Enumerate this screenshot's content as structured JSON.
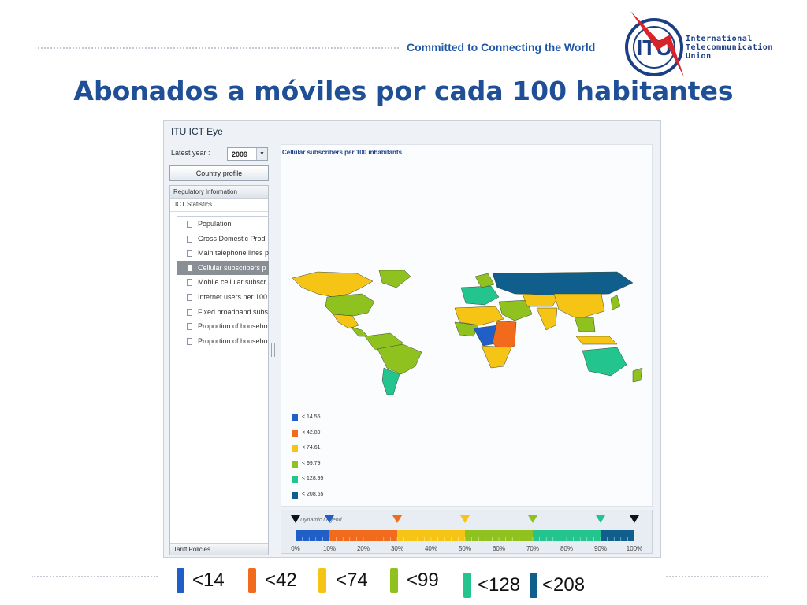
{
  "header": {
    "tagline": "Committed to Connecting the World",
    "logo_mark": "ITU",
    "logo_lines": [
      "International",
      "Telecommunication",
      "Union"
    ]
  },
  "slide_title": "Abonados a móviles por cada 100 habitantes",
  "app": {
    "title": "ITU ICT Eye",
    "year_label": "Latest year :",
    "year_value": "2009",
    "country_profile_button": "Country profile",
    "tree_header": "Regulatory Information",
    "tree_subheader": "ICT Statistics",
    "tree_items": [
      {
        "label": "Population",
        "selected": false
      },
      {
        "label": "Gross Domestic Prod",
        "selected": false
      },
      {
        "label": "Main telephone lines p",
        "selected": false
      },
      {
        "label": "Cellular subscribers p",
        "selected": true
      },
      {
        "label": "Mobile cellular subscr",
        "selected": false
      },
      {
        "label": "Internet users per 100",
        "selected": false
      },
      {
        "label": "Fixed broadband subs",
        "selected": false
      },
      {
        "label": "Proportion of househo",
        "selected": false
      },
      {
        "label": "Proportion of househo",
        "selected": false
      }
    ],
    "tree_footer": "Tariff Policies",
    "map_title": "Cellular subscribers per 100 inhabitants",
    "legend": [
      {
        "label": "< 14.55",
        "color": "#1f5fc7"
      },
      {
        "label": "< 42.89",
        "color": "#f26a1b"
      },
      {
        "label": "< 74.61",
        "color": "#f6c415"
      },
      {
        "label": "< 99.79",
        "color": "#8fc21f"
      },
      {
        "label": "< 128.95",
        "color": "#23c48e"
      },
      {
        "label": "< 208.65",
        "color": "#0f5e8c"
      }
    ],
    "dynamic_legend": {
      "title": "Dynamic Legend",
      "ticks": [
        "0%",
        "10%",
        "20%",
        "30%",
        "40%",
        "50%",
        "60%",
        "70%",
        "80%",
        "90%",
        "100%"
      ],
      "marker_positions_pct": [
        0,
        10,
        30,
        50,
        70,
        90,
        100
      ]
    }
  },
  "bottom_legend": [
    {
      "label": "<14",
      "color": "#1f5fc7"
    },
    {
      "label": "<42",
      "color": "#f26a1b"
    },
    {
      "label": "<74",
      "color": "#f6c415"
    },
    {
      "label": "<99",
      "color": "#8fc21f"
    },
    {
      "label": "<128",
      "color": "#23c48e"
    },
    {
      "label": "<208",
      "color": "#0f5e8c"
    }
  ],
  "map_regions": [
    {
      "name": "north-america",
      "color": "#f6c415"
    },
    {
      "name": "greenland",
      "color": "#8fc21f"
    },
    {
      "name": "usa",
      "color": "#8fc21f"
    },
    {
      "name": "mexico",
      "color": "#f6c415"
    },
    {
      "name": "central-america",
      "color": "#8fc21f"
    },
    {
      "name": "south-america-north",
      "color": "#8fc21f"
    },
    {
      "name": "brazil",
      "color": "#8fc21f"
    },
    {
      "name": "argentina",
      "color": "#23c48e"
    },
    {
      "name": "europe",
      "color": "#23c48e"
    },
    {
      "name": "scandinavia",
      "color": "#8fc21f"
    },
    {
      "name": "russia",
      "color": "#0f5e8c"
    },
    {
      "name": "north-africa",
      "color": "#f6c415"
    },
    {
      "name": "west-africa",
      "color": "#8fc21f"
    },
    {
      "name": "central-africa",
      "color": "#1f5fc7"
    },
    {
      "name": "east-africa",
      "color": "#f26a1b"
    },
    {
      "name": "southern-africa",
      "color": "#f6c415"
    },
    {
      "name": "middle-east",
      "color": "#8fc21f"
    },
    {
      "name": "central-asia",
      "color": "#f6c415"
    },
    {
      "name": "india",
      "color": "#f6c415"
    },
    {
      "name": "china",
      "color": "#f6c415"
    },
    {
      "name": "southeast-asia",
      "color": "#8fc21f"
    },
    {
      "name": "indonesia",
      "color": "#f6c415"
    },
    {
      "name": "australia",
      "color": "#23c48e"
    },
    {
      "name": "new-zealand",
      "color": "#8fc21f"
    },
    {
      "name": "japan",
      "color": "#8fc21f"
    }
  ]
}
